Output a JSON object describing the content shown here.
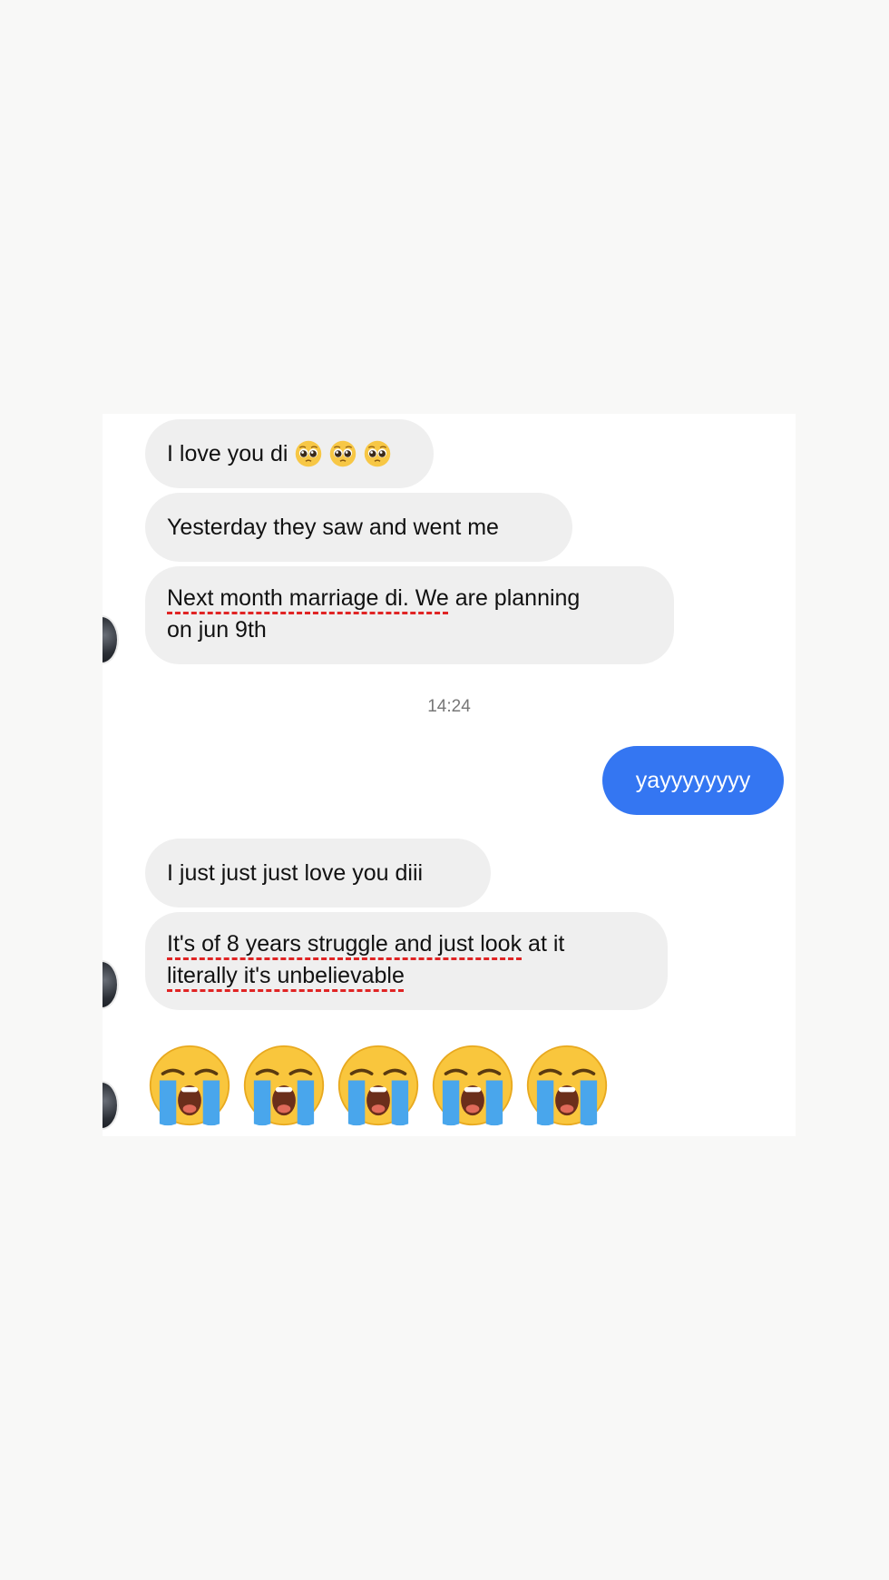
{
  "messages": {
    "m1": "I love you di",
    "m2": "Yesterday they saw and went me",
    "m3_line1_underlined": "Next month marriage di. We",
    "m3_line1_rest": " are planning",
    "m3_line2": "on jun 9th",
    "timestamp": "14:24",
    "sent": "yayyyyyyyy",
    "m4": "I just just just love you diii",
    "m5_line1_underlined": "It's of 8 years struggle and just look",
    "m5_line1_rest": " at it",
    "m5_line2_underlined": "literally it's unbelievable"
  },
  "icons": {
    "inline_emoji": "pleading-face-icon",
    "big_emoji": "loudly-crying-face-icon",
    "inline_emoji_count": 3,
    "big_emoji_count": 5
  },
  "colors": {
    "received_bubble": "#efefef",
    "sent_bubble": "#3476f2",
    "spellcheck_underline": "#e02424"
  }
}
